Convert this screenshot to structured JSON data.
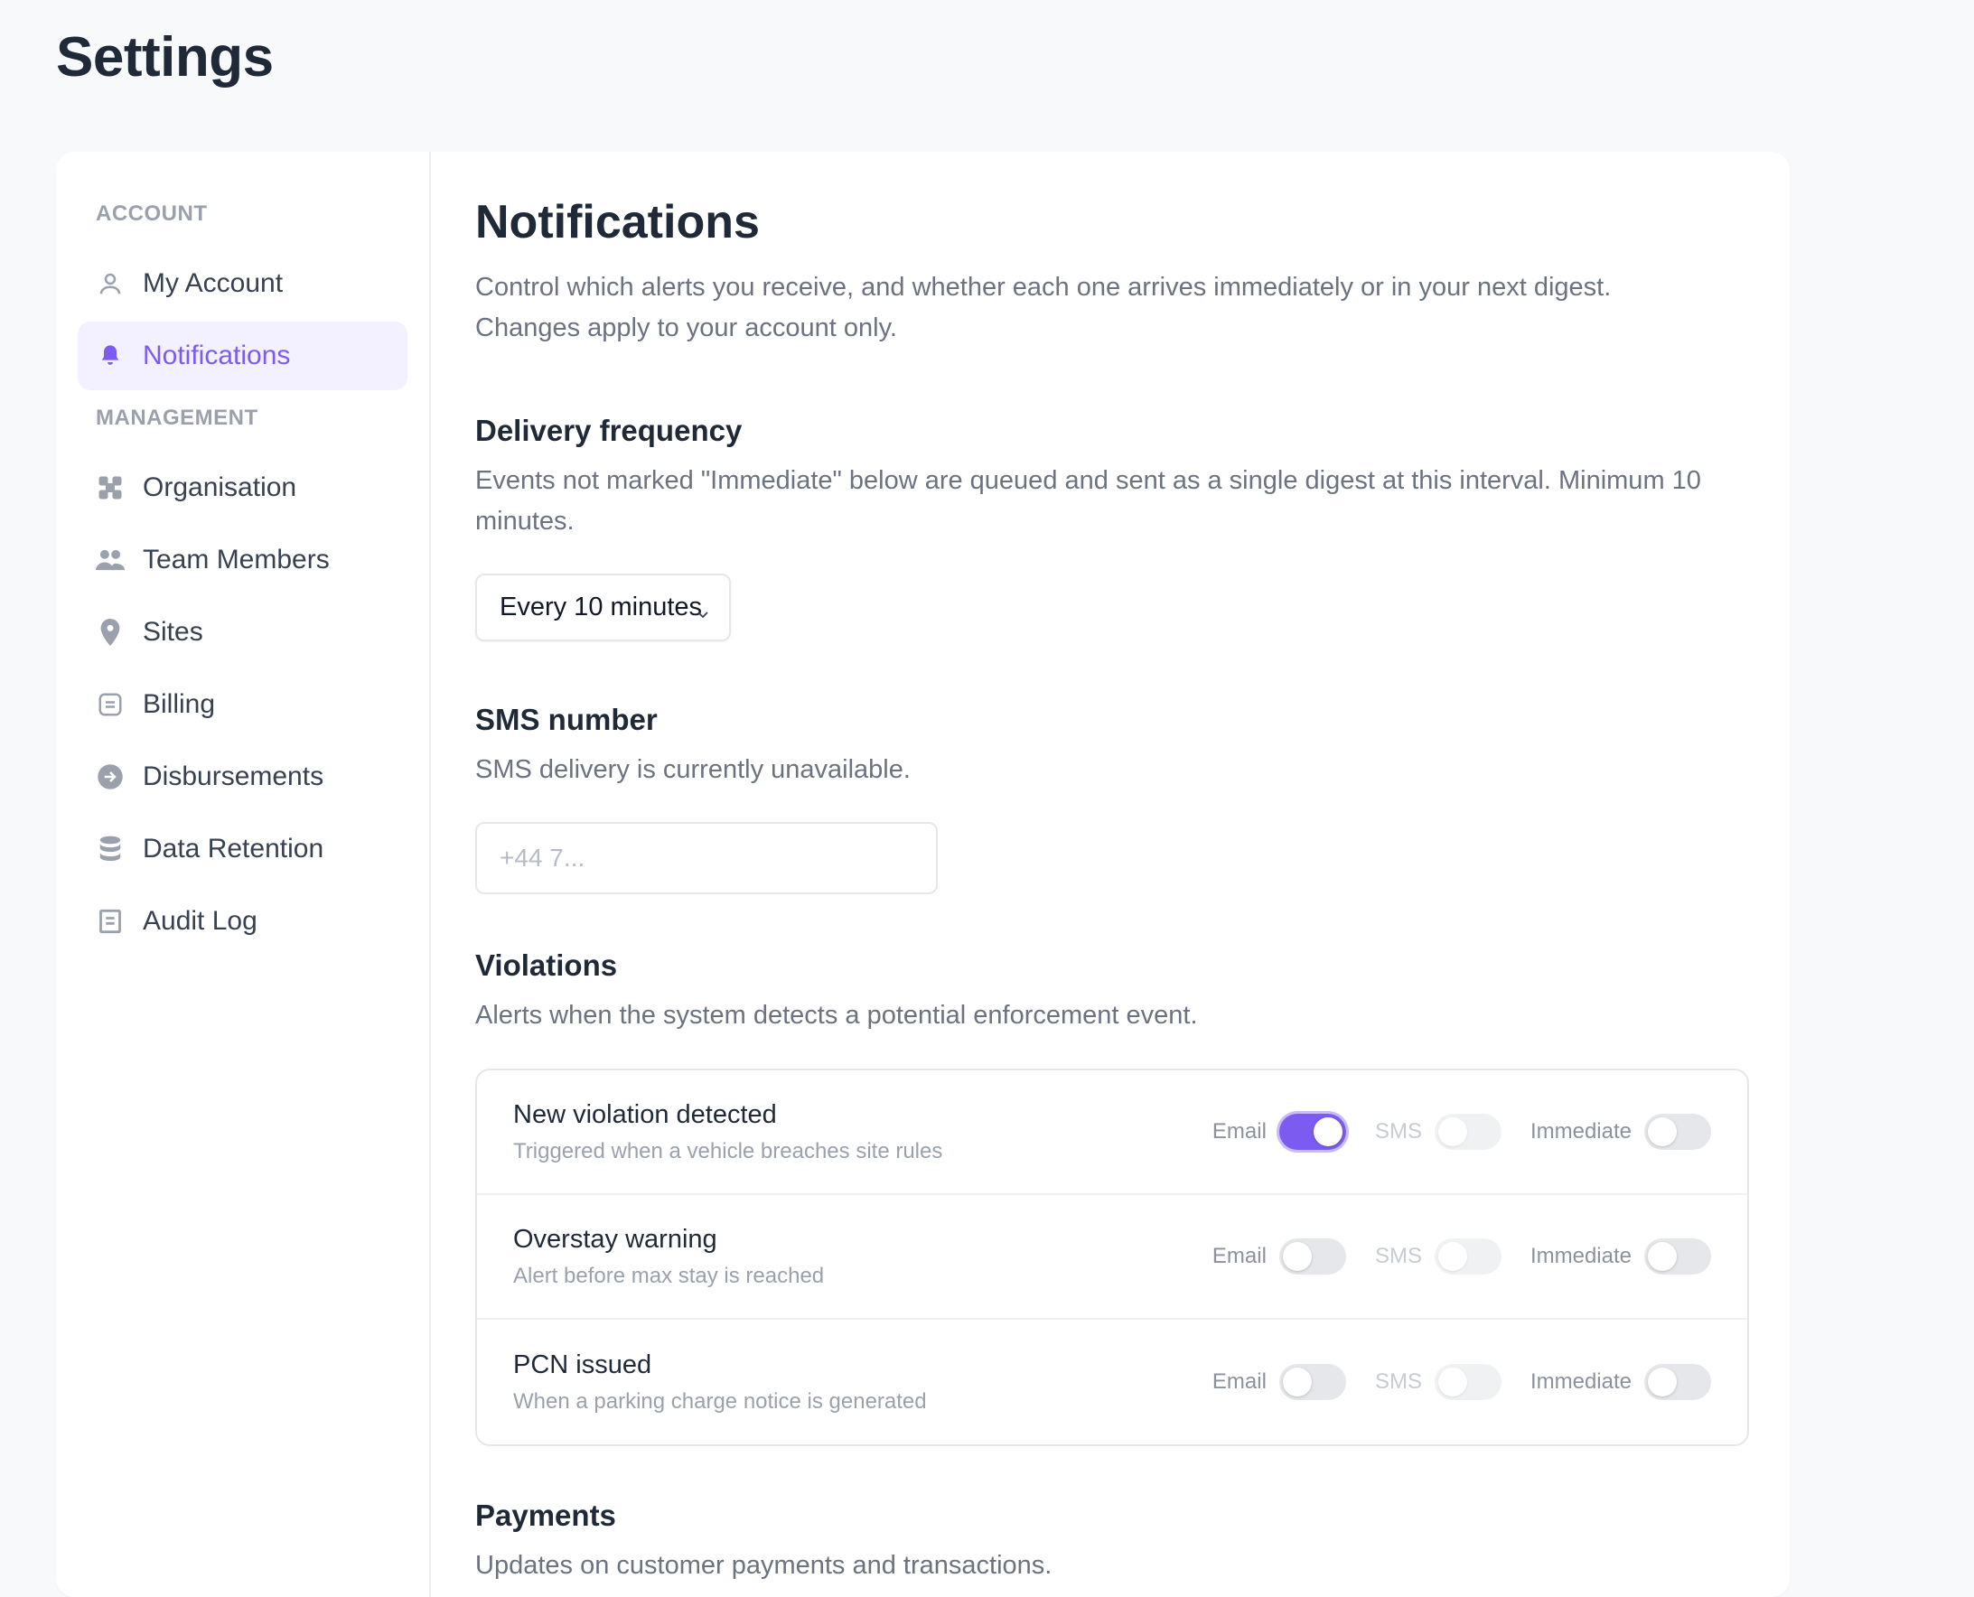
{
  "page_title": "Settings",
  "sidebar": {
    "account_label": "ACCOUNT",
    "account_items": [
      {
        "label": "My Account",
        "icon": "user-icon"
      },
      {
        "label": "Notifications",
        "icon": "bell-icon",
        "active": true
      }
    ],
    "management_label": "MANAGEMENT",
    "management_items": [
      {
        "label": "Organisation",
        "icon": "organisation-icon"
      },
      {
        "label": "Team Members",
        "icon": "team-icon"
      },
      {
        "label": "Sites",
        "icon": "location-pin-icon"
      },
      {
        "label": "Billing",
        "icon": "billing-icon"
      },
      {
        "label": "Disbursements",
        "icon": "arrow-circle-icon"
      },
      {
        "label": "Data Retention",
        "icon": "database-icon"
      },
      {
        "label": "Audit Log",
        "icon": "document-icon"
      }
    ]
  },
  "main": {
    "title": "Notifications",
    "intro_line1": "Control which alerts you receive, and whether each one arrives immediately or in your next digest.",
    "intro_line2": "Changes apply to your account only.",
    "delivery": {
      "heading": "Delivery frequency",
      "description": "Events not marked \"Immediate\" below are queued and sent as a single digest at this interval. Minimum 10 minutes.",
      "selected": "Every 10 minutes"
    },
    "sms": {
      "heading": "SMS number",
      "description": "SMS delivery is currently unavailable.",
      "placeholder": "+44 7..."
    },
    "violations": {
      "heading": "Violations",
      "description": "Alerts when the system detects a potential enforcement event.",
      "toggle_labels": {
        "email": "Email",
        "sms": "SMS",
        "immediate": "Immediate"
      },
      "rows": [
        {
          "title": "New violation detected",
          "desc": "Triggered when a vehicle breaches site rules",
          "email": true,
          "sms": false,
          "immediate": false
        },
        {
          "title": "Overstay warning",
          "desc": "Alert before max stay is reached",
          "email": false,
          "sms": false,
          "immediate": false
        },
        {
          "title": "PCN issued",
          "desc": "When a parking charge notice is generated",
          "email": false,
          "sms": false,
          "immediate": false
        }
      ]
    },
    "payments": {
      "heading": "Payments",
      "description": "Updates on customer payments and transactions."
    }
  },
  "colors": {
    "accent": "#7c5cf0",
    "active_bg": "#f3f0ff"
  }
}
